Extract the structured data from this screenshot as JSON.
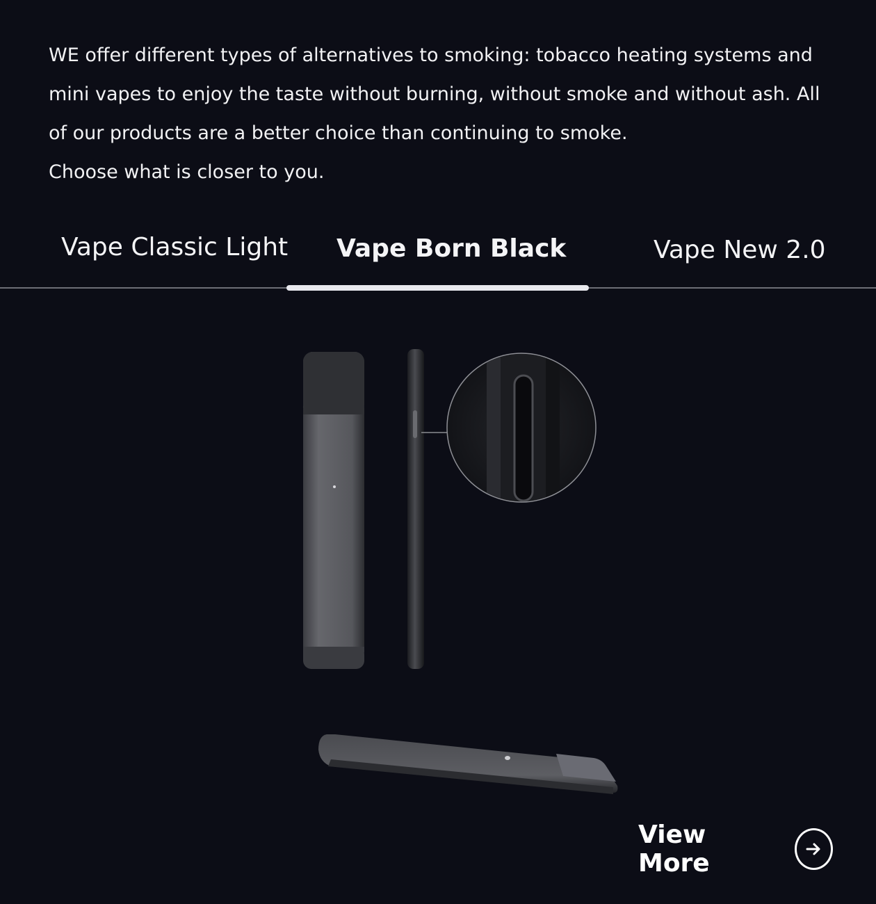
{
  "intro": {
    "paragraph": "WE offer different types of alternatives to smoking: tobacco heating systems and mini vapes to enjoy the taste without burning, without smoke and without ash. All of our products are a better choice than continuing to smoke.",
    "closing": "Choose what is closer to you."
  },
  "tabs": [
    {
      "label": "Vape Classic Light",
      "active": false
    },
    {
      "label": "Vape Born Black",
      "active": true
    },
    {
      "label": "Vape New 2.0",
      "active": false
    }
  ],
  "product": {
    "image": "vape-born-black-device-views"
  },
  "cta": {
    "label": "View More",
    "icon": "arrow-right-circle-icon"
  },
  "colors": {
    "background": "#0c0d16",
    "text": "#ffffff",
    "indicator": "#e9e9ee",
    "device_body": "#5b5c61",
    "device_cap": "#2e2f33"
  }
}
